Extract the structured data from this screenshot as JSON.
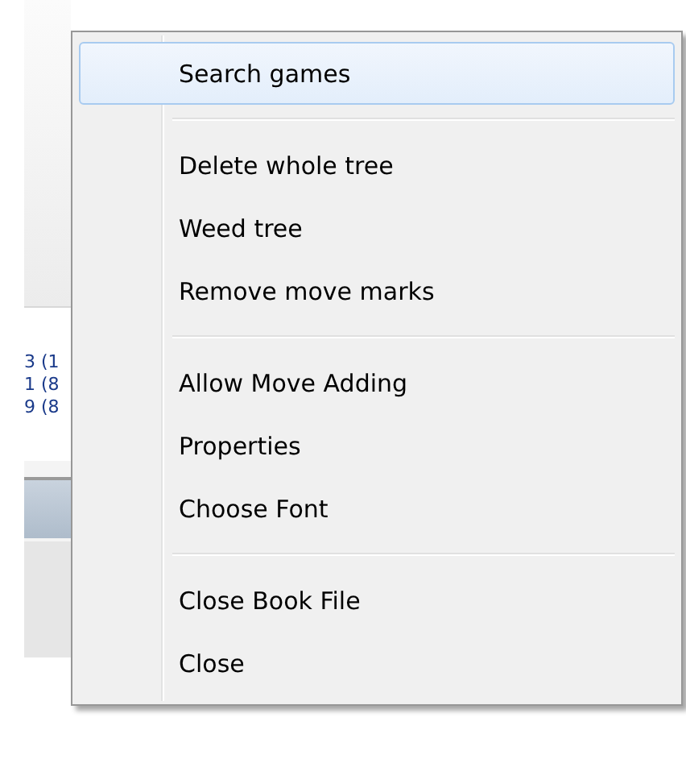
{
  "background_window": {
    "list_rows": [
      "3 (1",
      "1 (8",
      "9 (8"
    ]
  },
  "context_menu": {
    "sections": [
      {
        "items": [
          {
            "label": "Search games",
            "selected": true
          }
        ]
      },
      {
        "items": [
          {
            "label": "Delete whole tree",
            "selected": false
          },
          {
            "label": "Weed tree",
            "selected": false
          },
          {
            "label": "Remove move marks",
            "selected": false
          }
        ]
      },
      {
        "items": [
          {
            "label": "Allow Move Adding",
            "selected": false
          },
          {
            "label": "Properties",
            "selected": false
          },
          {
            "label": "Choose Font",
            "selected": false
          }
        ]
      },
      {
        "items": [
          {
            "label": "Close Book File",
            "selected": false
          },
          {
            "label": "Close",
            "selected": false
          }
        ]
      }
    ]
  }
}
